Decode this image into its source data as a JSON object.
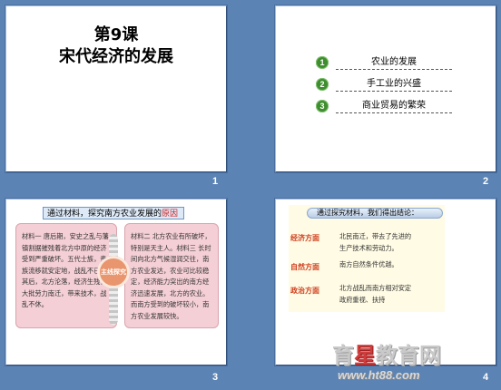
{
  "slides": [
    {
      "number": "1",
      "title_line1": "第9课",
      "title_line2": "宋代经济的发展"
    },
    {
      "number": "2",
      "items": [
        {
          "badge": "1",
          "label": "农业的发展"
        },
        {
          "badge": "2",
          "label": "手工业的兴盛"
        },
        {
          "badge": "3",
          "label": "商业贸易的繁荣"
        }
      ]
    },
    {
      "number": "3",
      "header_prefix": "通过材料，探究南方农业发展的",
      "header_highlight": "原因",
      "left_text": "材料一   唐后期，安史之乱与藩镇割据摧残着北方中原的经济受到严重破坏。五代士族，贵族流移就安定地，战乱不已。其后，北方沦落，经济生残，大批劳力南迁，带来技术，战乱不休。",
      "right_text": "材料二   北方农业有所破坏，特别是天主人。材料三   长时间向北方气候湿润交往，南方农业发达，农业可比较稳定，经济能力突出的南方经济迅速发展，北方的农业。而南方受到的破坏较小，南方农业发展较快。",
      "center_label": "主线探究"
    },
    {
      "number": "4",
      "pill": "通过探究材料，我们得出结论：",
      "rows": [
        {
          "label": "经济方面",
          "text1": "北民南迁，带去了先进的",
          "text2": "生产技术和劳动力。"
        },
        {
          "label": "自然方面",
          "text1": "南方自然条件优越。",
          "text2": ""
        },
        {
          "label": "政治方面",
          "text1": "北方战乱而南方相对安定",
          "text2": "政府重视、扶持"
        }
      ]
    }
  ],
  "watermark": {
    "prefix": "育",
    "star": "星",
    "suffix": "教育网",
    "url": "www.ht88.com"
  }
}
